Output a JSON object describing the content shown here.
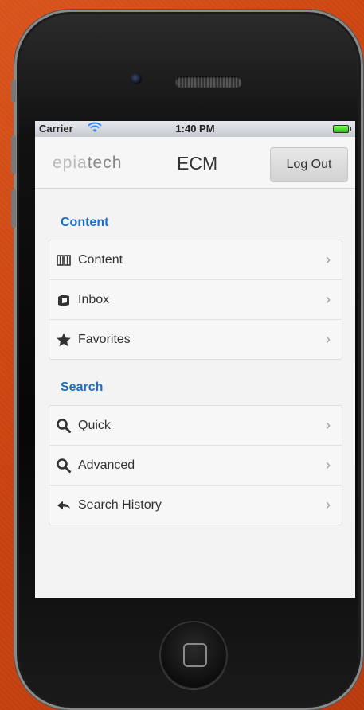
{
  "status": {
    "carrier": "Carrier",
    "time": "1:40 PM",
    "wifi_icon": "wifi-icon",
    "battery_icon": "battery-icon"
  },
  "header": {
    "logo_text_a": "epia",
    "logo_text_b": "tech",
    "title": "ECM",
    "logout_label": "Log Out"
  },
  "sections": [
    {
      "title": "Content",
      "items": [
        {
          "label": "Content",
          "icon": "book-icon"
        },
        {
          "label": "Inbox",
          "icon": "inbox-icon"
        },
        {
          "label": "Favorites",
          "icon": "star-icon"
        }
      ]
    },
    {
      "title": "Search",
      "items": [
        {
          "label": "Quick",
          "icon": "search-icon"
        },
        {
          "label": "Advanced",
          "icon": "search-icon"
        },
        {
          "label": "Search History",
          "icon": "back-arrow-icon"
        }
      ]
    }
  ],
  "chevron": "›",
  "colors": {
    "accent": "#1d6ec2",
    "background": "#d9531c"
  }
}
